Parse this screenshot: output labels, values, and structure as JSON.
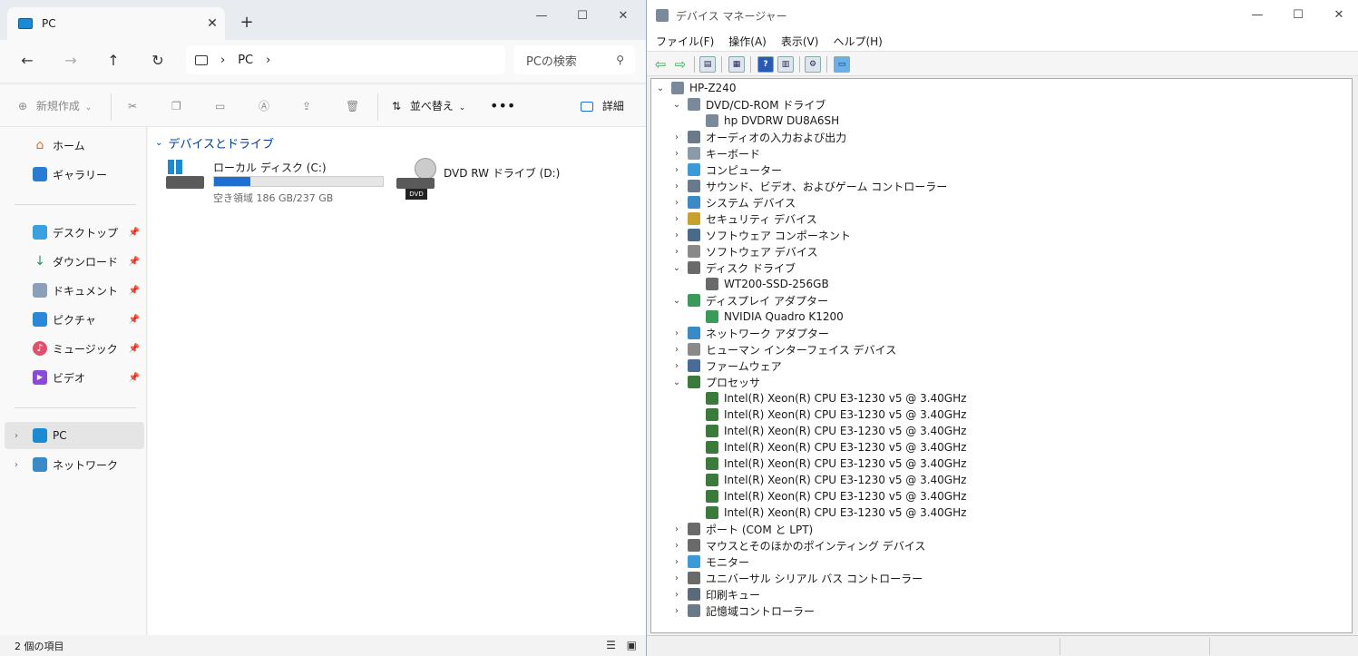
{
  "explorer": {
    "tab_title": "PC",
    "address": [
      "PC"
    ],
    "search_placeholder": "PCの検索",
    "toolbar": {
      "new_label": "新規作成",
      "sort_label": "並べ替え",
      "details_label": "詳細"
    },
    "nav": {
      "home": "ホーム",
      "gallery": "ギャラリー",
      "desktop": "デスクトップ",
      "downloads": "ダウンロード",
      "documents": "ドキュメント",
      "pictures": "ピクチャ",
      "music": "ミュージック",
      "videos": "ビデオ",
      "pc": "PC",
      "network": "ネットワーク"
    },
    "group_header": "デバイスとドライブ",
    "drives": [
      {
        "name": "ローカル ディスク (C:)",
        "free_text": "空き領域 186 GB/237 GB",
        "used_fraction": 0.215
      },
      {
        "name": "DVD RW ドライブ (D:)",
        "badge": "DVD"
      }
    ],
    "status": "2 個の項目",
    "colors": {
      "accent": "#1f6fd0",
      "group_header": "#003e92"
    }
  },
  "devmgr": {
    "title": "デバイス マネージャー",
    "menu": [
      "ファイル(F)",
      "操作(A)",
      "表示(V)",
      "ヘルプ(H)"
    ],
    "tree": {
      "root": "HP-Z240",
      "items": [
        {
          "label": "DVD/CD-ROM ドライブ",
          "expanded": true,
          "children": [
            "hp DVDRW  DU8A6SH"
          ]
        },
        {
          "label": "オーディオの入力および出力"
        },
        {
          "label": "キーボード"
        },
        {
          "label": "コンピューター"
        },
        {
          "label": "サウンド、ビデオ、およびゲーム コントローラー"
        },
        {
          "label": "システム デバイス"
        },
        {
          "label": "セキュリティ デバイス"
        },
        {
          "label": "ソフトウェア コンポーネント"
        },
        {
          "label": "ソフトウェア デバイス"
        },
        {
          "label": "ディスク ドライブ",
          "expanded": true,
          "children": [
            "WT200-SSD-256GB"
          ]
        },
        {
          "label": "ディスプレイ アダプター",
          "expanded": true,
          "children": [
            "NVIDIA Quadro K1200"
          ]
        },
        {
          "label": "ネットワーク アダプター"
        },
        {
          "label": "ヒューマン インターフェイス デバイス"
        },
        {
          "label": "ファームウェア"
        },
        {
          "label": "プロセッサ",
          "expanded": true,
          "children": [
            "Intel(R) Xeon(R) CPU E3-1230 v5 @ 3.40GHz",
            "Intel(R) Xeon(R) CPU E3-1230 v5 @ 3.40GHz",
            "Intel(R) Xeon(R) CPU E3-1230 v5 @ 3.40GHz",
            "Intel(R) Xeon(R) CPU E3-1230 v5 @ 3.40GHz",
            "Intel(R) Xeon(R) CPU E3-1230 v5 @ 3.40GHz",
            "Intel(R) Xeon(R) CPU E3-1230 v5 @ 3.40GHz",
            "Intel(R) Xeon(R) CPU E3-1230 v5 @ 3.40GHz",
            "Intel(R) Xeon(R) CPU E3-1230 v5 @ 3.40GHz"
          ]
        },
        {
          "label": "ポート (COM と LPT)"
        },
        {
          "label": "マウスとそのほかのポインティング デバイス"
        },
        {
          "label": "モニター"
        },
        {
          "label": "ユニバーサル シリアル バス コントローラー"
        },
        {
          "label": "印刷キュー"
        },
        {
          "label": "記憶域コントローラー"
        }
      ]
    }
  }
}
